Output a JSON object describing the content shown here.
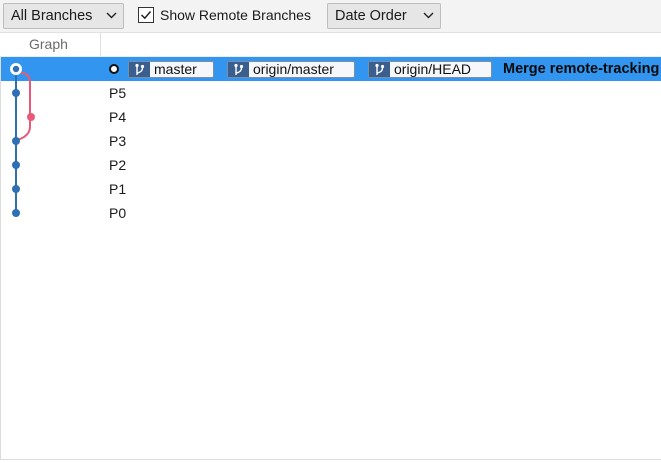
{
  "toolbar": {
    "branches_label": "All Branches",
    "show_remote_label": "Show Remote Branches",
    "show_remote_checked": true,
    "order_label": "Date Order"
  },
  "header": {
    "graph_label": "Graph"
  },
  "commits": [
    {
      "message": "Merge remote-tracking",
      "selected": true,
      "refs": [
        "master",
        "origin/master",
        "origin/HEAD"
      ]
    },
    {
      "message": "P5"
    },
    {
      "message": "P4"
    },
    {
      "message": "P3"
    },
    {
      "message": "P2"
    },
    {
      "message": "P1"
    },
    {
      "message": "P0"
    }
  ],
  "colors": {
    "selection": "#3296f0",
    "main_lane": "#2f6fb5",
    "branch_lane": "#e85a78",
    "ref_icon_bg": "#3a5f8f"
  },
  "icons": {
    "dropdown": "chevron-down-icon",
    "checkbox": "checkmark-icon",
    "ref": "git-branch-icon",
    "head": "head-marker-icon"
  }
}
